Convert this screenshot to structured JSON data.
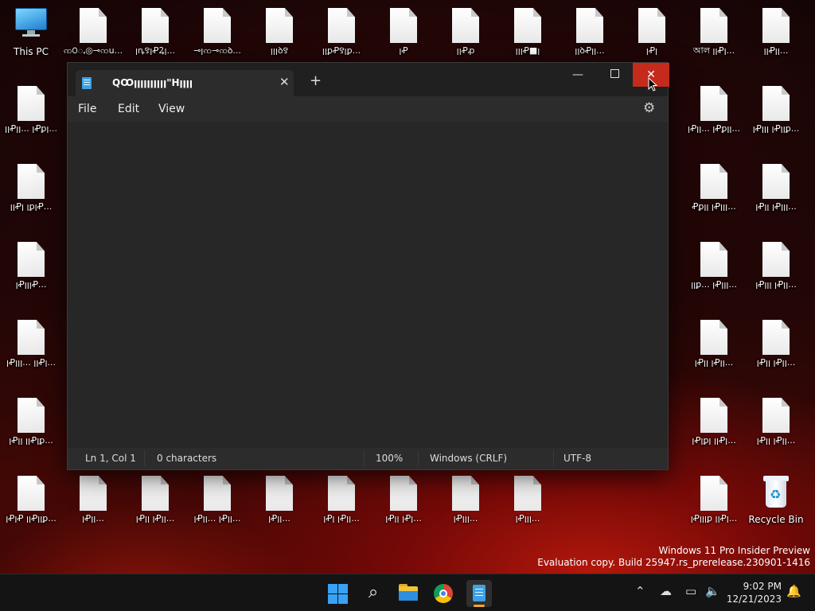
{
  "desktop": {
    "this_pc_label": "This PC",
    "recycle_bin_label": "Recycle Bin",
    "top_row": [
      "ꩡ꯰ꩻ◎⊸ꩡu...",
      "ꞁꝴ꯱ꞁꝒꝜꞁ...",
      "⊸ꞁꩡ⊸ꩡꝺ...",
      "ꞁꞁꞁꝺ꯱",
      "ꞁꞁꝑꝒ꯱ꞁꝑ...",
      "ꞁꝒ",
      "ꞁꞁꝒꝓ",
      "ꞁꞁꞁꝒ■ꞁ",
      "ꞁꞁꝺꝒꞁꞁ...",
      "ꞁꝒꞁ",
      "আল ꞁꞁꝒꞁ...",
      "ꞁꞁꝒꞁꞁ..."
    ],
    "left_col": [
      "ꞁꞁꝒꞁꞁ... ꞁꝒꝑꞁ...",
      "ꞁꞁꝒꞁ ꞁꝑꞁꝒ...",
      "ꞁꝒꞁꞁꞁꝒ...",
      "ꞁꝒꞁꞁꞁ... ꞁꞁꝒꞁ...",
      "ꞁꝒꞁꞁ ꞁꞁꝒꞁꝑ...",
      "ꞁꝒꞁꝒ ꞁꞁꝒꞁꞁꝑ..."
    ],
    "right_col_a": [
      "ꞁꝒꞁꞁ... ꞁꝒꝑꞁꞁ...",
      "Ꝓꝑꞁꞁ ꞁꝒꞁꞁꞁ...",
      "ꞁꞁꝑ... ꞁꝒꞁꞁꞁ...",
      "ꞁꝒꞁꞁ ꞁꝒꞁꞁ...",
      "ꞁꝒꞁꝑꞁ ꞁꞁꝒꞁ...",
      "ꞁꝒꞁꞁꞁꝑ ꞁꞁꝒꞁ..."
    ],
    "right_col_b": [
      "ꞁꝒꞁꞁꞁ ꞁꝒꞁꞁꝑ...",
      "ꞁꝒꞁꞁ ꞁꝒꞁꞁꞁ...",
      "ꞁꝒꞁꞁꞁ ꞁꝒꞁꞁ...",
      "ꞁꝒꞁꞁ ꞁꝒꞁꞁ...",
      "ꞁꝒꞁꞁ ꞁꝒꞁꞁ..."
    ],
    "bottom_row": [
      "ꞁꝒꞁꞁ...",
      "ꞁꝒꞁꞁ ꞁꝒꞁꞁ...",
      "ꞁꝒꞁꞁ... ꞁꝒꞁꞁ...",
      "ꞁꝒꞁꞁ...",
      "ꞁꝒꞁ ꞁꝒꞁꞁ...",
      "ꞁꝒꞁꞁ ꞁꝒꞁ...",
      "ꞁꝒꞁꞁꞁ...",
      "ꞁꝒꞁꞁꞁ..."
    ],
    "watermark_line1": "Windows 11 Pro Insider Preview",
    "watermark_line2": "Evaluation copy. Build 25947.rs_prerelease.230901-1416"
  },
  "notepad": {
    "tab_title": "QꝎꞁꞁꞁꞁꞁꞁꞁꞁꞁꞁ\"Hꞁꞁꞁꞁ",
    "new_tab_symbol": "+",
    "menu": [
      "File",
      "Edit",
      "View"
    ],
    "status": {
      "position": "Ln 1, Col 1",
      "chars": "0 characters",
      "zoom": "100%",
      "line_endings": "Windows (CRLF)",
      "encoding": "UTF-8"
    }
  },
  "taskbar": {
    "time": "9:02 PM",
    "date": "12/21/2023"
  },
  "colors": {
    "close_hover": "#c42b1c",
    "notepad_blue": "#3ea1e6",
    "start_blue": "#3aa2f5"
  }
}
